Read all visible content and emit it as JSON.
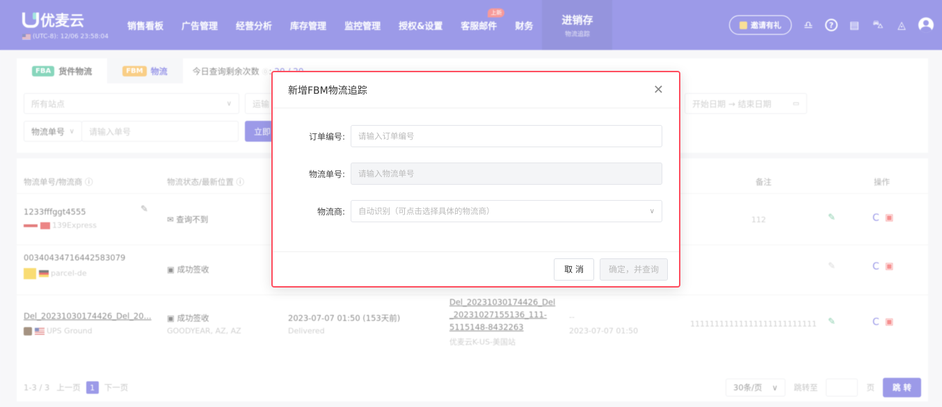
{
  "app": {
    "name": "优麦云",
    "utc_label": "(UTC-8): 12/06 23:58:04"
  },
  "nav": {
    "items": [
      {
        "label": "销售看板"
      },
      {
        "label": "广告管理"
      },
      {
        "label": "经营分析"
      },
      {
        "label": "库存管理"
      },
      {
        "label": "监控管理"
      },
      {
        "label": "授权&设置"
      },
      {
        "label": "客服邮件",
        "badge": "上新"
      },
      {
        "label": "财务"
      }
    ],
    "active": {
      "label": "进销存",
      "sub": "物流追踪"
    },
    "invite_label": "邀请有礼"
  },
  "tabs": {
    "fba": {
      "tag": "FBA",
      "label": "货件物流"
    },
    "fbm": {
      "tag": "FBM",
      "label": "物流"
    },
    "quota_label": "今日查询剩余次数",
    "quota_value": "20 / 20"
  },
  "filters": {
    "site_placeholder": "所有站点",
    "carrier_placeholder": "运输",
    "tracking_type": "物流单号",
    "tracking_placeholder": "请输入单号",
    "search_btn": "立即",
    "date_range": "开始日期  →  结束日期"
  },
  "table": {
    "headers": {
      "tracking": "物流单号/物流商",
      "status": "物流状态/最新位置",
      "remark": "备注",
      "action": "操作"
    },
    "rows": [
      {
        "tracking": "1233fffggt4555",
        "carrier": "139Express",
        "status": "查询不到",
        "remark": "112"
      },
      {
        "tracking": "00340434716442583079",
        "carrier": "parcel-de",
        "status": "成功签收"
      },
      {
        "tracking": "Del_20231030174426_Del_20...",
        "carrier": "UPS Ground",
        "status": "成功签收",
        "location": "GOODYEAR, AZ, AZ",
        "time": "2023-07-07 01:50  (153天前)",
        "time_status": "Delivered",
        "order_lines": [
          "Del_20231030174426_Del",
          "_20231027155136_111-",
          "5115148-8432263"
        ],
        "shop": "优麦云K-US-美国站",
        "dash": "--",
        "update_time": "2023-07-07 01:50",
        "remark": "11111111111111111111111111"
      }
    ]
  },
  "pager": {
    "summary": "1-3 / 3",
    "prev": "上一页",
    "current": "1",
    "next": "下一页",
    "page_size": "30条/页",
    "jump_label": "跳转至",
    "page_unit": "页",
    "jump_btn": "跳 转"
  },
  "modal": {
    "title": "新增FBM物流追踪",
    "order_label": "订单编号:",
    "order_placeholder": "请输入订单编号",
    "tracking_label": "物流单号:",
    "tracking_placeholder": "请输入物流单号",
    "carrier_label": "物流商:",
    "carrier_placeholder": "自动识别（可点击选择具体的物流商）",
    "cancel": "取 消",
    "confirm": "确定，并查询"
  }
}
